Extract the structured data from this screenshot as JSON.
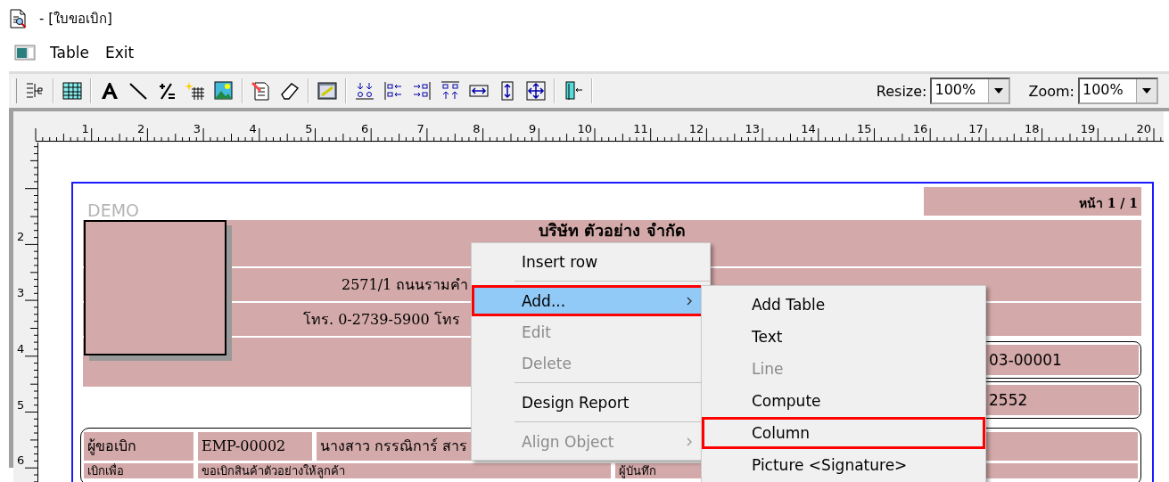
{
  "window": {
    "title": "- [ใบขอเบิก]"
  },
  "menu_bar": [
    "Table",
    "Exit"
  ],
  "toolbar": {
    "resize": {
      "label": "Resize:",
      "value": "100%"
    },
    "zoom": {
      "label": "Zoom:",
      "value": "100%"
    }
  },
  "ruler": {
    "horizontal": [
      "1",
      "2",
      "3",
      "4",
      "5",
      "6",
      "7",
      "8",
      "9",
      "10",
      "11",
      "12",
      "13",
      "14",
      "15",
      "16",
      "17",
      "18",
      "19",
      "20"
    ],
    "vertical": [
      "2",
      "3",
      "4",
      "5",
      "6"
    ]
  },
  "report": {
    "watermark": "DEMO",
    "page_number": "หน้า 1 / 1",
    "company": "บริษัท ตัวอย่าง จำกัด",
    "address": "2571/1 ถนนรามคำ",
    "phone": "โทร. 0-2739-5900   โทร",
    "doc_fields": [
      "03-00001",
      "2552"
    ],
    "rows": [
      [
        "ผู้ขอเบิก",
        "EMP-00002",
        "นางสาว กรรณิการ์ สาร"
      ],
      [
        "เบิกเพื่อ",
        "ขอเบิกสินค้าตัวอย่างให้ลูกค้า",
        "ผู้บันทึก"
      ]
    ]
  },
  "context_menu": {
    "items": [
      {
        "label": "Insert row",
        "selected": false,
        "disabled": false,
        "submenu": false,
        "highlighted": false,
        "separator_after": true
      },
      {
        "label": "Add...",
        "selected": true,
        "disabled": false,
        "submenu": true,
        "highlighted": true,
        "separator_after": false
      },
      {
        "label": "Edit",
        "selected": false,
        "disabled": true,
        "submenu": false,
        "highlighted": false,
        "separator_after": false
      },
      {
        "label": "Delete",
        "selected": false,
        "disabled": true,
        "submenu": false,
        "highlighted": false,
        "separator_after": true
      },
      {
        "label": "Design Report",
        "selected": false,
        "disabled": false,
        "submenu": false,
        "highlighted": false,
        "separator_after": true
      },
      {
        "label": "Align Object",
        "selected": false,
        "disabled": true,
        "submenu": true,
        "highlighted": false,
        "separator_after": false
      }
    ]
  },
  "submenu": {
    "items": [
      {
        "label": "Add Table",
        "selected": false,
        "disabled": false,
        "highlighted": false
      },
      {
        "label": "Text",
        "selected": false,
        "disabled": false,
        "highlighted": false
      },
      {
        "label": "Line",
        "selected": false,
        "disabled": true,
        "highlighted": false
      },
      {
        "label": "Compute",
        "selected": false,
        "disabled": false,
        "highlighted": false
      },
      {
        "label": "Column",
        "selected": false,
        "disabled": false,
        "highlighted": true
      },
      {
        "label": "Picture <Signature>",
        "selected": false,
        "disabled": false,
        "highlighted": false
      }
    ]
  }
}
